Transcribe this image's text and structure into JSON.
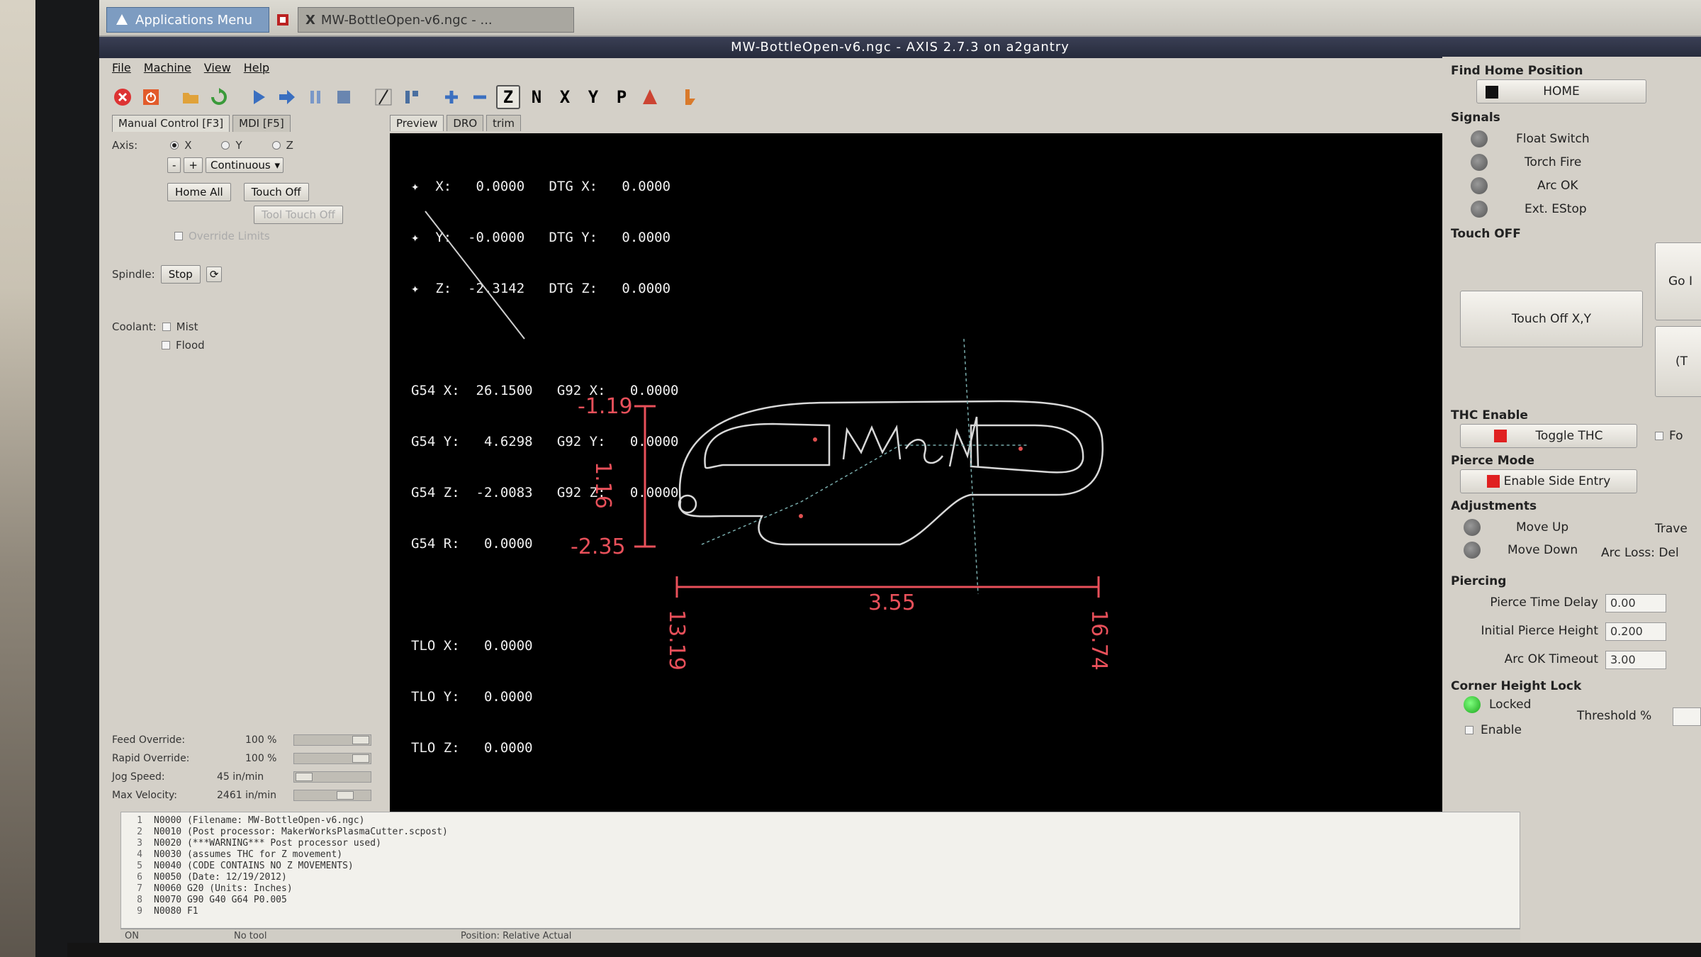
{
  "taskbar": {
    "apps_menu": "Applications Menu",
    "window_task": "MW-BottleOpen-v6.ngc - ..."
  },
  "window": {
    "title": "MW-BottleOpen-v6.ngc - AXIS 2.7.3 on a2gantry"
  },
  "menu": [
    "File",
    "Machine",
    "View",
    "Help"
  ],
  "toolbar_icons": [
    "estop-icon",
    "power-icon",
    "open-icon",
    "reload-icon",
    "run-icon",
    "step-icon",
    "pause-icon",
    "stop-icon",
    "block-delete-icon",
    "optional-stop-icon",
    "zoom-in-icon",
    "zoom-out-icon",
    "view-z-icon",
    "view-z2-icon",
    "view-x-icon",
    "view-y-icon",
    "view-p-icon",
    "clear-plot-icon",
    "toggle-tool-icon"
  ],
  "left": {
    "tab_manual": "Manual Control [F3]",
    "tab_mdi": "MDI [F5]",
    "axis_label": "Axis:",
    "axes": [
      "X",
      "Y",
      "Z"
    ],
    "selected_axis": "X",
    "jog_minus": "-",
    "jog_plus": "+",
    "jog_mode": "Continuous",
    "home_all": "Home All",
    "touch_off": "Touch Off",
    "tool_touch_off": "Tool Touch Off",
    "override_limits": "Override Limits",
    "spindle_label": "Spindle:",
    "spindle_stop": "Stop",
    "coolant_label": "Coolant:",
    "mist": "Mist",
    "flood": "Flood",
    "feed_override_label": "Feed Override:",
    "feed_override": "100 %",
    "feed_override_level": 1.0,
    "rapid_override_label": "Rapid Override:",
    "rapid_override": "100 %",
    "rapid_override_level": 1.0,
    "jog_speed_label": "Jog Speed:",
    "jog_speed": "45 in/min",
    "max_velocity_label": "Max Velocity:",
    "max_velocity": "2461 in/min"
  },
  "preview_tabs": [
    "Preview",
    "DRO",
    "trim"
  ],
  "dro": {
    "lines": [
      "✦  X:   0.0000   DTG X:   0.0000",
      "✦  Y:  -0.0000   DTG Y:   0.0000",
      "✦  Z:  -2.3142   DTG Z:   0.0000",
      "",
      "G54 X:  26.1500   G92 X:   0.0000",
      "G54 Y:   4.6298   G92 Y:   0.0000",
      "G54 Z:  -2.0083   G92 Z:   0.0000",
      "G54 R:   0.0000",
      "",
      "TLO X:   0.0000",
      "TLO Y:   0.0000",
      "TLO Z:   0.0000"
    ]
  },
  "extents": {
    "y_max": "-1.19",
    "height": "1.16",
    "y_min": "-2.35",
    "width": "3.55",
    "x_min": "13.19",
    "x_max": "16.74",
    "color": "#e8505a"
  },
  "right": {
    "find_home": "Find Home Position",
    "home": "HOME",
    "signals": "Signals",
    "signal_items": [
      "Float Switch",
      "Torch Fire",
      "Arc OK",
      "Ext. EStop"
    ],
    "touch_off_title": "Touch OFF",
    "touch_off_xy": "Touch Off X,Y",
    "go_partial": "Go I",
    "t_partial": "(T",
    "thc_enable": "THC Enable",
    "toggle_thc": "Toggle THC",
    "f_partial": "Fo",
    "pierce_mode": "Pierce Mode",
    "enable_side_entry": "Enable Side Entry",
    "adjustments": "Adjustments",
    "move_up": "Move Up",
    "move_down": "Move Down",
    "trave_partial": "Trave",
    "arc_loss_partial": "Arc Loss: Del",
    "piercing": "Piercing",
    "pierce_time_delay_label": "Pierce Time Delay",
    "pierce_time_delay": "0.00",
    "initial_pierce_height_label": "Initial Pierce Height",
    "initial_pierce_height": "0.200",
    "arc_ok_timeout_label": "Arc OK Timeout",
    "arc_ok_timeout": "3.00",
    "corner_height_lock": "Corner Height Lock",
    "locked": "Locked",
    "enable": "Enable",
    "threshold": "Threshold %"
  },
  "gcode": [
    {
      "n": "1",
      "text": "N0000 (Filename: MW-BottleOpen-v6.ngc)"
    },
    {
      "n": "2",
      "text": "N0010 (Post processor: MakerWorksPlasmaCutter.scpost)"
    },
    {
      "n": "3",
      "text": "N0020 (***WARNING*** Post processor used)"
    },
    {
      "n": "4",
      "text": "N0030 (assumes THC for Z movement)"
    },
    {
      "n": "5",
      "text": "N0040 (CODE CONTAINS NO Z MOVEMENTS)"
    },
    {
      "n": "6",
      "text": "N0050 (Date: 12/19/2012)"
    },
    {
      "n": "7",
      "text": "N0060    G20 (Units: Inches)"
    },
    {
      "n": "8",
      "text": "N0070 G90 G40 G64 P0.005"
    },
    {
      "n": "9",
      "text": "N0080 F1"
    }
  ],
  "status": {
    "state": "ON",
    "tool": "No tool",
    "position": "Position: Relative Actual"
  }
}
